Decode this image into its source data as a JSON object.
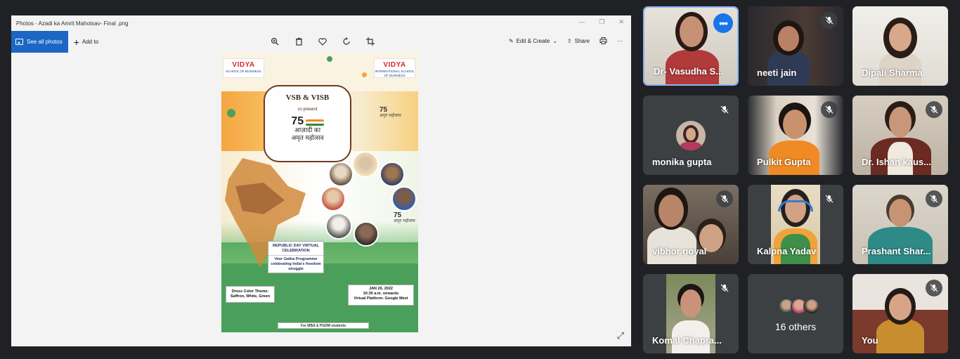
{
  "photos_app": {
    "title": "Photos - Azadi ka Amrit Mahotsav- Final .png",
    "see_all_label": "See all photos",
    "add_to_label": "Add to",
    "edit_create_label": "Edit & Create",
    "share_label": "Share",
    "more_label": "···",
    "window_controls": [
      "—",
      "❐",
      "✕"
    ],
    "icons": [
      "zoom-icon",
      "delete-icon",
      "heart-icon",
      "rotate-icon",
      "crop-icon"
    ]
  },
  "poster": {
    "logo_left_brand": "VIDYA",
    "logo_left_sub": "SCHOOL OF BUSINESS",
    "logo_right_brand": "VIDYA",
    "logo_right_sub": "INTERNATIONAL SCHOOL OF BUSINESS",
    "org_title": "VSB & VISB",
    "co_present": "co present",
    "emblem_number": "75",
    "hindi_line1": "आज़ादी का",
    "hindi_line2": "अमृत महोत्सव",
    "event_title": "REPUBLIC DAY VIRTUAL CELEBRATION",
    "programme": "Veer Gatha Programme celebrating India's freedom struggle",
    "dress_title": "Dress Color Theme:",
    "dress_colors": "Saffron, White, Green",
    "date": "JAN 26, 2022",
    "time": "10:30 a.m. onwards",
    "platform": "Virtual Platform- Google Meet",
    "footer": "For MBA & PGDM students"
  },
  "participants": [
    {
      "name": "Dr- Vasudha S...",
      "active": true,
      "muted": false
    },
    {
      "name": "neeti jain",
      "muted": true
    },
    {
      "name": "Dipali Sharma",
      "muted": false
    },
    {
      "name": "monika gupta",
      "muted": true
    },
    {
      "name": "Pulkit Gupta",
      "muted": true
    },
    {
      "name": "Dr. Ishan kaus...",
      "muted": true
    },
    {
      "name": "vibhor goyal",
      "muted": true
    },
    {
      "name": "Kalpna Yadav",
      "muted": true
    },
    {
      "name": "Prashant Shar...",
      "muted": true
    },
    {
      "name": "Komal Chapra...",
      "muted": true
    },
    {
      "name": "16 others",
      "muted": false
    },
    {
      "name": "You",
      "muted": true
    }
  ],
  "colors": {
    "accent": "#1a73e8",
    "active_border": "#8ab4f8",
    "tile_bg": "#3c4043",
    "page_bg": "#202124"
  }
}
